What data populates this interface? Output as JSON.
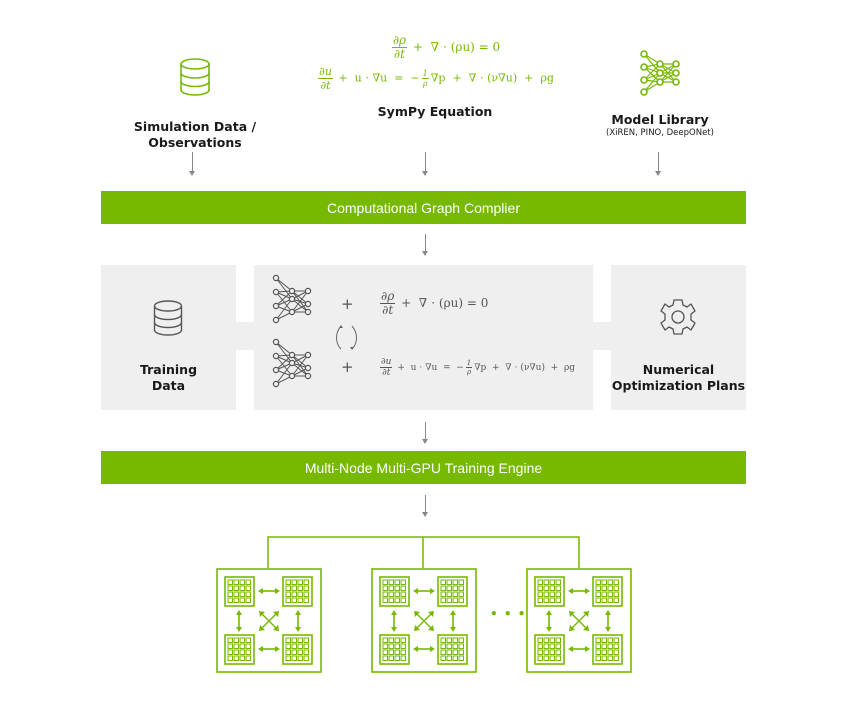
{
  "inputs": {
    "simulation_data": {
      "label_line1": "Simulation Data /",
      "label_line2": "Observations",
      "icon": "database-icon"
    },
    "sympy_equation": {
      "label": "SymPy Equation",
      "eq1": {
        "frac_num": "∂ρ",
        "frac_den": "∂t",
        "rest": "+  ∇ ⋅ (ρu) = 0"
      },
      "eq2": {
        "frac_num": "∂u",
        "frac_den": "∂t",
        "rest_a": "+  u ⋅ ∇u  =  −",
        "frac2_num": "1",
        "frac2_den": "ρ",
        "rest_b": "∇p  +  ∇ ⋅ (ν∇u)  +  ρg"
      }
    },
    "model_library": {
      "label": "Model Library",
      "sublabel": "(XiREN, PINO, DeepONet)",
      "icon": "neural-network-icon"
    }
  },
  "compiler_bar": {
    "label": "Computational Graph Complier"
  },
  "middle": {
    "training_data": {
      "label_line1": "Training",
      "label_line2": "Data",
      "icon": "database-icon"
    },
    "center": {
      "plus": "+",
      "eq1": {
        "frac_num": "∂ρ",
        "frac_den": "∂t",
        "rest": "+  ∇ ⋅ (ρu) = 0"
      },
      "eq2": {
        "frac_num": "∂u",
        "frac_den": "∂t",
        "rest_a": "+  u ⋅ ∇u  =  −",
        "frac2_num": "1",
        "frac2_den": "ρ",
        "rest_b": "∇p  +  ∇ ⋅ (ν∇u)  +  ρg"
      }
    },
    "optimization": {
      "label_line1": "Numerical",
      "label_line2": "Optimization Plans",
      "icon": "gear-icon"
    }
  },
  "training_bar": {
    "label": "Multi-Node Multi-GPU Training Engine"
  },
  "nodes": {
    "count_shown": 3,
    "ellipsis": "• • •",
    "gpus_per_node": 4
  },
  "colors": {
    "accent": "#76b900",
    "panel": "#efefef",
    "gray_icon": "#555555",
    "arrow": "#888888"
  }
}
